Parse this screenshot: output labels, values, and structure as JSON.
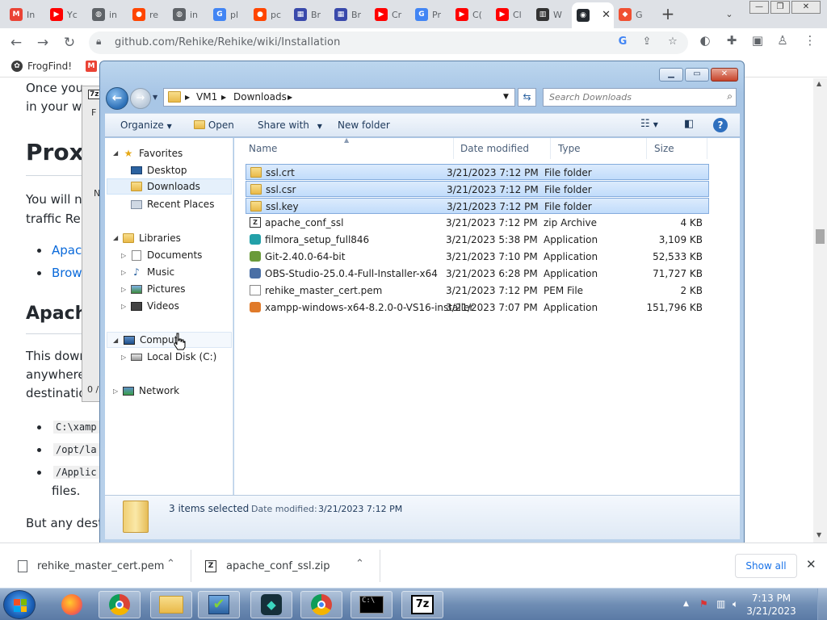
{
  "tabs": [
    {
      "label": "In",
      "icon": "gmail-icon",
      "color": "#ea4335",
      "glyph": "M"
    },
    {
      "label": "Yc",
      "icon": "youtube-icon",
      "color": "#ff0000",
      "glyph": "▶"
    },
    {
      "label": "in",
      "icon": "globe-icon",
      "color": "#5f6368",
      "glyph": "◍"
    },
    {
      "label": "re",
      "icon": "reddit-icon",
      "color": "#ff4500",
      "glyph": "●"
    },
    {
      "label": "in",
      "icon": "globe-icon",
      "color": "#5f6368",
      "glyph": "◍"
    },
    {
      "label": "pl",
      "icon": "google-icon",
      "color": "#4285f4",
      "glyph": "G"
    },
    {
      "label": "pc",
      "icon": "reddit-icon",
      "color": "#ff4500",
      "glyph": "●"
    },
    {
      "label": "Br",
      "icon": "bookmark-site-icon",
      "color": "#3949ab",
      "glyph": "▦"
    },
    {
      "label": "Br",
      "icon": "bookmark-site-icon",
      "color": "#3949ab",
      "glyph": "▦"
    },
    {
      "label": "Cr",
      "icon": "youtube-icon",
      "color": "#ff0000",
      "glyph": "▶"
    },
    {
      "label": "Pr",
      "icon": "google-icon",
      "color": "#4285f4",
      "glyph": "G"
    },
    {
      "label": "C(",
      "icon": "youtube-icon",
      "color": "#ff0000",
      "glyph": "▶"
    },
    {
      "label": "Cl",
      "icon": "youtube-icon",
      "color": "#ff0000",
      "glyph": "▶"
    },
    {
      "label": "W",
      "icon": "wikipedia-icon",
      "color": "#333333",
      "glyph": "▥"
    },
    {
      "label": "",
      "icon": "github-icon",
      "color": "#24292f",
      "glyph": "◉",
      "active": true
    },
    {
      "label": "G",
      "icon": "git-icon",
      "color": "#f05032",
      "glyph": "◆"
    }
  ],
  "browser": {
    "url": "github.com/Rehike/Rehike/wiki/Installation",
    "lock_icon": "lock-icon",
    "bookmarks": [
      {
        "label": "FrogFind!",
        "icon": "frogfind-icon"
      },
      {
        "label": "",
        "icon": "gmail-icon"
      }
    ]
  },
  "web": {
    "intro_1": "Once you",
    "intro_2": "in your we",
    "heading_proxy": "Proxy",
    "proxy_p1": "You will n",
    "proxy_p2": "traffic Reh",
    "link_apache": "Apac",
    "link_browser": "Brow",
    "heading_apache": "Apache",
    "apache_p1": "This down",
    "apache_p2": "anywhere",
    "apache_p3": "destinatio",
    "code_1": "C:\\xamp",
    "code_2": "/opt/la",
    "code_3": "/Applic",
    "files_text": "files.",
    "but_any": "But any desti"
  },
  "bg_window": {
    "title_glyph": "7z",
    "f_label": "F",
    "n_label": "N",
    "zero_label": "0 /"
  },
  "explorer": {
    "breadcrumb": [
      "VM1",
      "Downloads"
    ],
    "search_placeholder": "Search Downloads",
    "commands": {
      "organize": "Organize",
      "open": "Open",
      "share_with": "Share with",
      "new_folder": "New folder"
    },
    "nav": {
      "favorites": "Favorites",
      "desktop": "Desktop",
      "downloads": "Downloads",
      "recent": "Recent Places",
      "libraries": "Libraries",
      "documents": "Documents",
      "music": "Music",
      "pictures": "Pictures",
      "videos": "Videos",
      "computer": "Comput",
      "local_disk": "Local Disk (C:)",
      "network": "Network"
    },
    "columns": {
      "name": "Name",
      "date": "Date modified",
      "type": "Type",
      "size": "Size"
    },
    "files": [
      {
        "name": "ssl.crt",
        "date": "3/21/2023 7:12 PM",
        "type": "File folder",
        "size": "",
        "kind": "folder",
        "selected": true
      },
      {
        "name": "ssl.csr",
        "date": "3/21/2023 7:12 PM",
        "type": "File folder",
        "size": "",
        "kind": "folder",
        "selected": true
      },
      {
        "name": "ssl.key",
        "date": "3/21/2023 7:12 PM",
        "type": "File folder",
        "size": "",
        "kind": "folder",
        "selected": true
      },
      {
        "name": "apache_conf_ssl",
        "date": "3/21/2023 7:12 PM",
        "type": "zip Archive",
        "size": "4 KB",
        "kind": "zip",
        "selected": false
      },
      {
        "name": "filmora_setup_full846",
        "date": "3/21/2023 5:38 PM",
        "type": "Application",
        "size": "3,109 KB",
        "kind": "app",
        "color": "#22a0a8",
        "selected": false
      },
      {
        "name": "Git-2.40.0-64-bit",
        "date": "3/21/2023 7:10 PM",
        "type": "Application",
        "size": "52,533 KB",
        "kind": "app",
        "color": "#6a9a3a",
        "selected": false
      },
      {
        "name": "OBS-Studio-25.0.4-Full-Installer-x64",
        "date": "3/21/2023 6:28 PM",
        "type": "Application",
        "size": "71,727 KB",
        "kind": "app",
        "color": "#4a6fa5",
        "selected": false
      },
      {
        "name": "rehike_master_cert.pem",
        "date": "3/21/2023 7:12 PM",
        "type": "PEM File",
        "size": "2 KB",
        "kind": "doc",
        "selected": false
      },
      {
        "name": "xampp-windows-x64-8.2.0-0-VS16-installer",
        "date": "3/21/2023 7:07 PM",
        "type": "Application",
        "size": "151,796 KB",
        "kind": "app",
        "color": "#e07a2a",
        "selected": false
      }
    ],
    "details": {
      "selected_count": "3 items selected",
      "date_label": "Date modified:",
      "date_value": "3/21/2023 7:12 PM"
    }
  },
  "downloads": [
    {
      "name": "rehike_master_cert.pem",
      "icon": "file-icon"
    },
    {
      "name": "apache_conf_ssl.zip",
      "icon": "zip-file-icon"
    }
  ],
  "download_bar": {
    "show_all": "Show all"
  },
  "taskbar": {
    "apps": [
      "firefox-icon",
      "chrome-icon",
      "file-explorer-icon",
      "installer-icon",
      "filmora-icon",
      "chrome-icon",
      "command-prompt-icon",
      "7zip-icon"
    ],
    "time": "7:13 PM",
    "date": "3/21/2023"
  }
}
